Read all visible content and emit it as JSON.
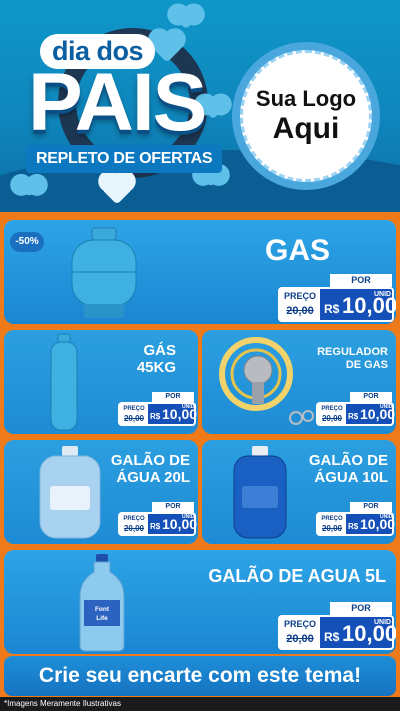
{
  "header": {
    "title_top": "dia dos",
    "title_main": "PAIS",
    "subtitle": "REPLETO DE OFERTAS",
    "logo_line1": "Sua Logo",
    "logo_line2": "Aqui"
  },
  "discount_badge": "-50%",
  "products": [
    {
      "name_line1": "GAS",
      "name_line2": "",
      "price_label": "PREÇO",
      "old_price": "20,00",
      "currency": "R$",
      "price": "10,00",
      "unit": "UNID",
      "por": "POR",
      "image": "gas-cylinder-icon"
    },
    {
      "name_line1": "GÁS",
      "name_line2": "45KG",
      "price_label": "PREÇO",
      "old_price": "20,00",
      "currency": "R$",
      "price": "10,00",
      "unit": "UNID",
      "por": "POR",
      "image": "tall-cylinder-icon"
    },
    {
      "name_line1": "REGULADOR",
      "name_line2": "DE GAS",
      "price_label": "PREÇO",
      "old_price": "20,00",
      "currency": "R$",
      "price": "10,00",
      "unit": "UNID",
      "por": "POR",
      "image": "gas-regulator-icon"
    },
    {
      "name_line1": "GALÃO DE",
      "name_line2": "ÁGUA 20L",
      "price_label": "PREÇO",
      "old_price": "20,00",
      "currency": "R$",
      "price": "10,00",
      "unit": "UNID",
      "por": "POR",
      "image": "water-jug-20l-icon"
    },
    {
      "name_line1": "GALÃO DE",
      "name_line2": "ÁGUA 10L",
      "price_label": "PREÇO",
      "old_price": "20,00",
      "currency": "R$",
      "price": "10,00",
      "unit": "UNID",
      "por": "POR",
      "image": "water-jug-10l-icon"
    },
    {
      "name_line1": "GALÃO DE AGUA 5L",
      "name_line2": "",
      "price_label": "PREÇO",
      "old_price": "20,00",
      "currency": "R$",
      "price": "10,00",
      "unit": "UNID",
      "por": "POR",
      "image": "water-bottle-5l-icon",
      "bottle_brand": "Font Life"
    }
  ],
  "cta": "Crie seu encarte com este tema!",
  "footnote": "*Imagens Meramente Ilustrativas",
  "colors": {
    "background": "#ef7a1a",
    "card": "#1e8bd4",
    "price_box": "#1450b8",
    "cta": "#1673c0"
  }
}
